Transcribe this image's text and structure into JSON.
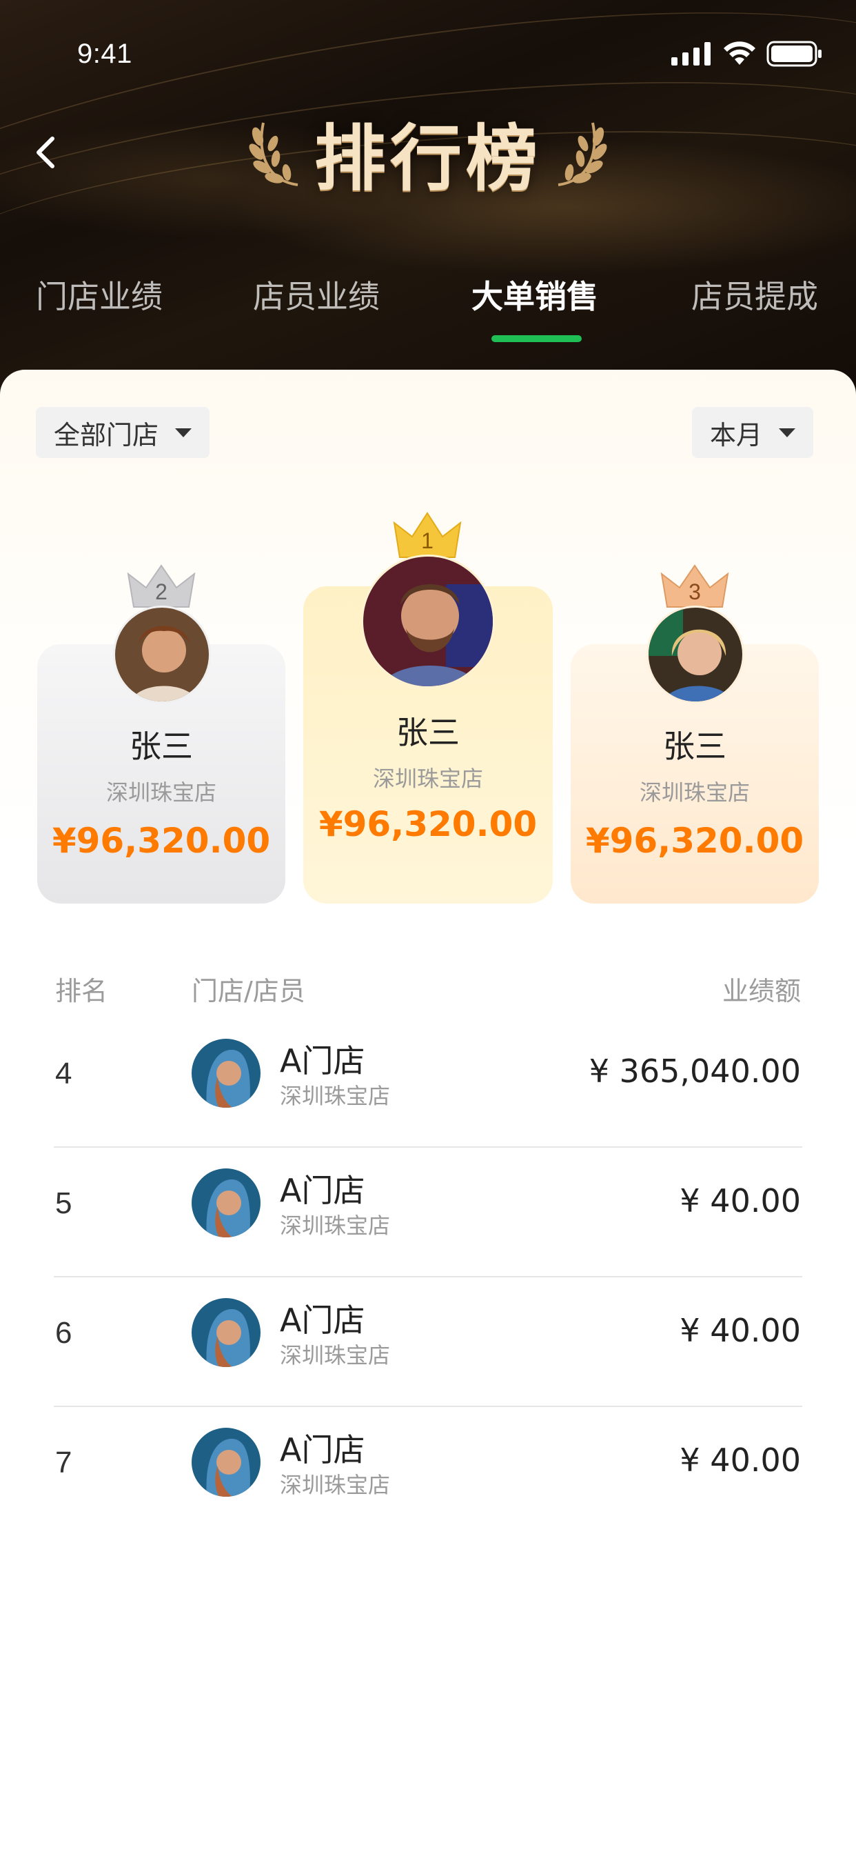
{
  "status_bar": {
    "time": "9:41"
  },
  "header": {
    "title": "排行榜"
  },
  "tabs": [
    {
      "label": "门店业绩",
      "active": false
    },
    {
      "label": "店员业绩",
      "active": false
    },
    {
      "label": "大单销售",
      "active": true
    },
    {
      "label": "店员提成",
      "active": false
    }
  ],
  "filters": {
    "store": "全部门店",
    "period": "本月"
  },
  "podium": [
    {
      "rank": "2",
      "name": "张三",
      "store": "深圳珠宝店",
      "amount": "¥96,320.00"
    },
    {
      "rank": "1",
      "name": "张三",
      "store": "深圳珠宝店",
      "amount": "¥96,320.00"
    },
    {
      "rank": "3",
      "name": "张三",
      "store": "深圳珠宝店",
      "amount": "¥96,320.00"
    }
  ],
  "list_header": {
    "rank": "排名",
    "member": "门店/店员",
    "amount": "业绩额"
  },
  "rows": [
    {
      "rank": "4",
      "name": "A门店",
      "store": "深圳珠宝店",
      "amount": "¥ 365,040.00"
    },
    {
      "rank": "5",
      "name": "A门店",
      "store": "深圳珠宝店",
      "amount": "¥ 40.00"
    },
    {
      "rank": "6",
      "name": "A门店",
      "store": "深圳珠宝店",
      "amount": "¥ 40.00"
    },
    {
      "rank": "7",
      "name": "A门店",
      "store": "深圳珠宝店",
      "amount": "¥ 40.00"
    }
  ],
  "colors": {
    "accent_green": "#1fbf55",
    "amount_orange": "#ff7a00",
    "gold": "#f6e3c4"
  }
}
